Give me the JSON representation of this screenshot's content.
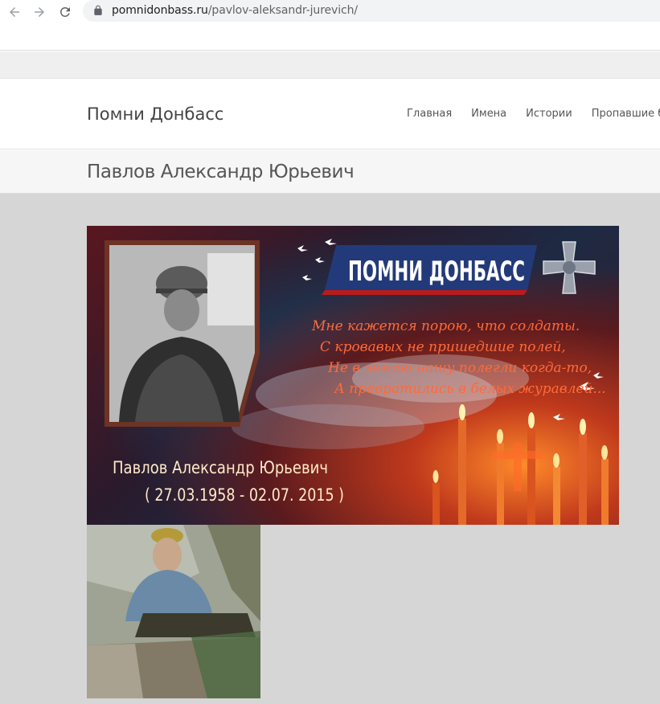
{
  "browser": {
    "url_host": "pomnidonbass.ru",
    "url_path": "/pavlov-aleksandr-jurevich/"
  },
  "site": {
    "title": "Помни Донбасс",
    "menu": [
      "Главная",
      "Имена",
      "Истории",
      "Пропавшие без вести"
    ]
  },
  "page": {
    "title": "Павлов Александр Юрьевич"
  },
  "banner": {
    "logo_text": "ПОМНИ ДОНБАСС",
    "poem": [
      "Мне кажется порою, что солдаты.",
      "С кровавых не пришедшие полей,",
      "Не в землю нашу полегли когда-то,",
      "А превратились в белых журавлей..."
    ],
    "name": "Павлов Александр Юрьевич",
    "dates": "(  27.03.1958 - 02.07. 2015  )"
  },
  "colors": {
    "poem_text": "#ff6a3a",
    "banner_name": "#ffe9c8"
  }
}
